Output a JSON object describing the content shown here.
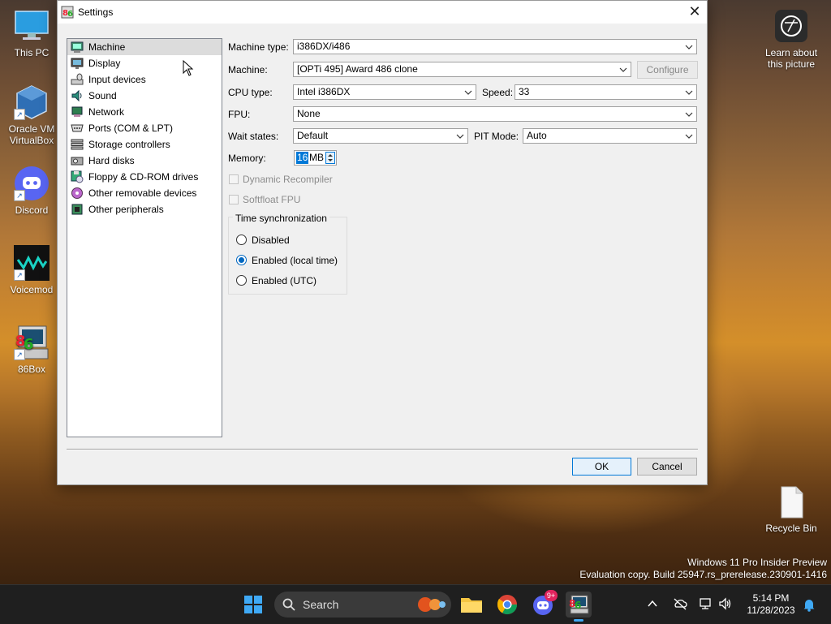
{
  "desktop": {
    "icons": [
      {
        "label": "This PC"
      },
      {
        "label": "Oracle VM VirtualBox"
      },
      {
        "label": "Discord"
      },
      {
        "label": "Voicemod"
      },
      {
        "label": "86Box"
      },
      {
        "label": "Learn about this picture"
      },
      {
        "label": "Recycle Bin"
      }
    ],
    "watermark": {
      "line1": "Windows 11 Pro Insider Preview",
      "line2": "Evaluation copy. Build 25947.rs_prerelease.230901-1416"
    }
  },
  "window": {
    "title": "Settings",
    "close_glyph": "✕",
    "nav": [
      {
        "label": "Machine",
        "icon": "machine-icon",
        "selected": true
      },
      {
        "label": "Display",
        "icon": "display-icon"
      },
      {
        "label": "Input devices",
        "icon": "input-devices-icon"
      },
      {
        "label": "Sound",
        "icon": "sound-icon"
      },
      {
        "label": "Network",
        "icon": "network-icon"
      },
      {
        "label": "Ports (COM & LPT)",
        "icon": "ports-icon"
      },
      {
        "label": "Storage controllers",
        "icon": "storage-icon"
      },
      {
        "label": "Hard disks",
        "icon": "hard-disk-icon"
      },
      {
        "label": "Floppy & CD-ROM drives",
        "icon": "floppy-icon"
      },
      {
        "label": "Other removable devices",
        "icon": "removable-icon"
      },
      {
        "label": "Other peripherals",
        "icon": "peripherals-icon"
      }
    ],
    "machine": {
      "machine_type_label": "Machine type:",
      "machine_type_value": "i386DX/i486",
      "machine_label": "Machine:",
      "machine_value": "[OPTi 495] Award 486 clone",
      "configure_label": "Configure",
      "cpu_type_label": "CPU type:",
      "cpu_type_value": "Intel i386DX",
      "speed_label": "Speed:",
      "speed_value": "33",
      "fpu_label": "FPU:",
      "fpu_value": "None",
      "wait_states_label": "Wait states:",
      "wait_states_value": "Default",
      "pit_mode_label": "PIT Mode:",
      "pit_mode_value": "Auto",
      "memory_label": "Memory:",
      "memory_value": "16",
      "memory_unit": "MB",
      "dynamic_recompiler_label": "Dynamic Recompiler",
      "softfloat_label": "Softfloat FPU",
      "time_sync": {
        "title": "Time synchronization",
        "options": [
          {
            "label": "Disabled",
            "checked": false
          },
          {
            "label": "Enabled (local time)",
            "checked": true
          },
          {
            "label": "Enabled (UTC)",
            "checked": false
          }
        ]
      }
    },
    "ok_label": "OK",
    "cancel_label": "Cancel"
  },
  "taskbar": {
    "search_label": "Search",
    "discord_badge": "9+",
    "clock_time": "5:14 PM",
    "clock_date": "11/28/2023"
  },
  "colors": {
    "accent": "#0067c0",
    "taskbar": "#1f1f1f"
  }
}
